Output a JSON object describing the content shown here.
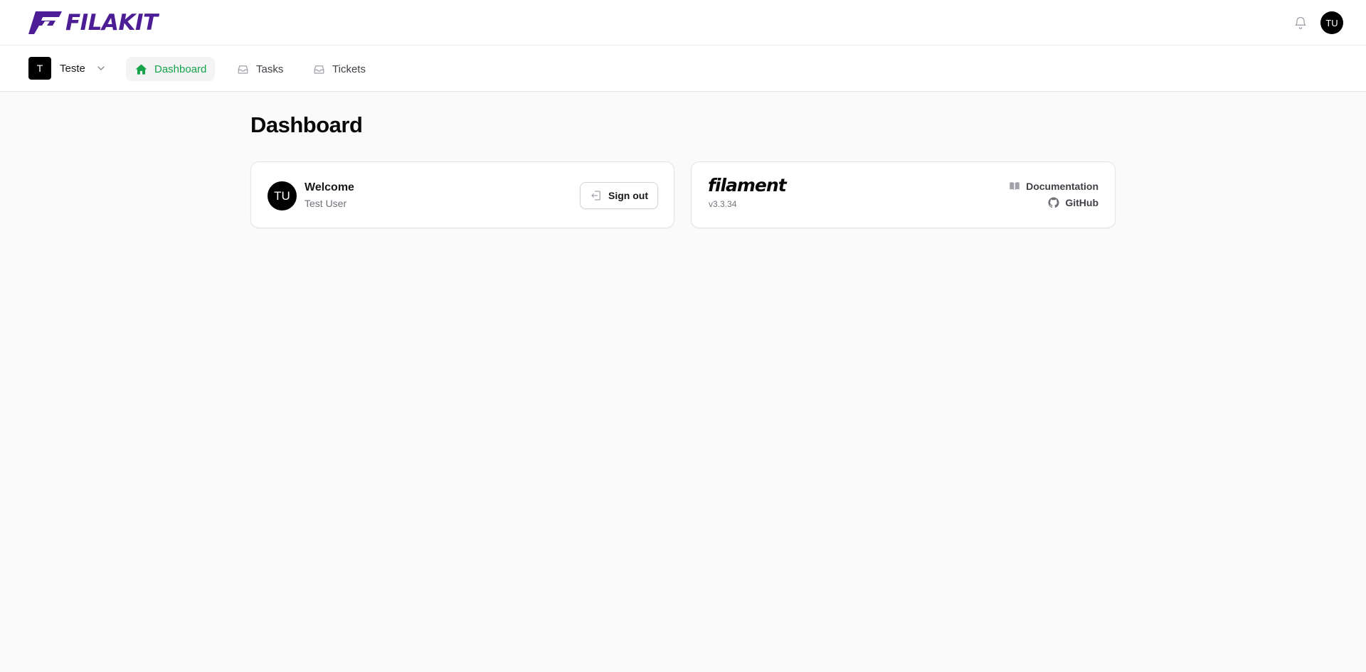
{
  "brand": {
    "name": "FILAKIT",
    "color": "#4c1d95"
  },
  "topbar": {
    "notifications_icon": "bell-icon",
    "user_initials": "TU"
  },
  "navbar": {
    "tenant": {
      "initial": "T",
      "name": "Teste"
    },
    "items": [
      {
        "label": "Dashboard",
        "icon": "home-icon",
        "active": true
      },
      {
        "label": "Tasks",
        "icon": "inbox-icon",
        "active": false
      },
      {
        "label": "Tickets",
        "icon": "inbox-icon",
        "active": false
      }
    ],
    "active_color": "#16a34a"
  },
  "main": {
    "title": "Dashboard",
    "welcome_card": {
      "avatar_initials": "TU",
      "heading": "Welcome",
      "user_name": "Test User",
      "signout_label": "Sign out"
    },
    "filament_card": {
      "logo_text": "filament",
      "version": "v3.3.34",
      "documentation_label": "Documentation",
      "github_label": "GitHub"
    }
  }
}
